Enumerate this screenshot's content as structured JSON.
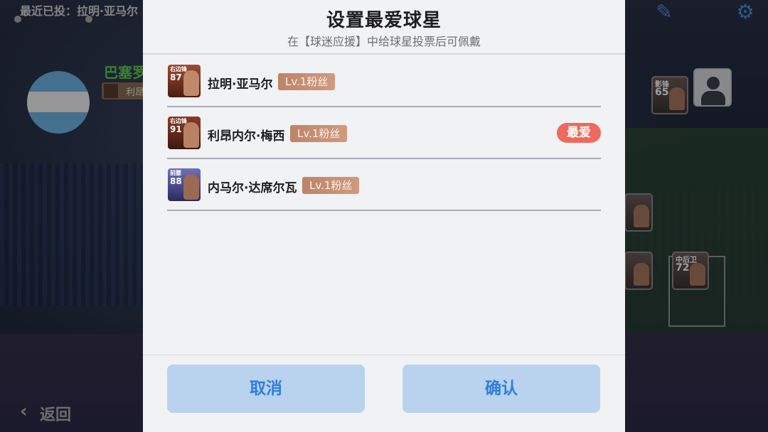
{
  "background": {
    "recent_vote_text": "最近已投：拉明·亚马尔",
    "club_name": "巴塞罗",
    "favorite_chip_text": "利昂",
    "back_label": "返回",
    "edit_icon": "edit-icon",
    "settings_icon": "gear-icon",
    "player_cards": [
      {
        "pos": "影锋",
        "rating": "65"
      },
      {
        "pos": "中后卫",
        "rating": "72"
      }
    ]
  },
  "dialog": {
    "title": "设置最爱球星",
    "subtitle": "在【球迷应援】中给球星投票后可佩戴",
    "players": [
      {
        "name": "拉明·亚马尔",
        "card_pos": "右边锋",
        "rating": "87",
        "fan_level": "Lv.1粉丝",
        "is_favorite": false
      },
      {
        "name": "利昂内尔·梅西",
        "card_pos": "右边锋",
        "rating": "91",
        "fan_level": "Lv.1粉丝",
        "is_favorite": true
      },
      {
        "name": "内马尔·达席尔瓦",
        "card_pos": "前腰",
        "rating": "88",
        "fan_level": "Lv.1粉丝",
        "is_favorite": false
      }
    ],
    "favorite_badge": "最爱",
    "cancel_label": "取消",
    "confirm_label": "确认"
  },
  "colors": {
    "dialog_bg": "#f1f2f4",
    "button_bg": "#b9d2ee",
    "button_text": "#2e7fd8",
    "fan_badge": "#c98d72",
    "favorite_badge": "#ee6a5c"
  }
}
